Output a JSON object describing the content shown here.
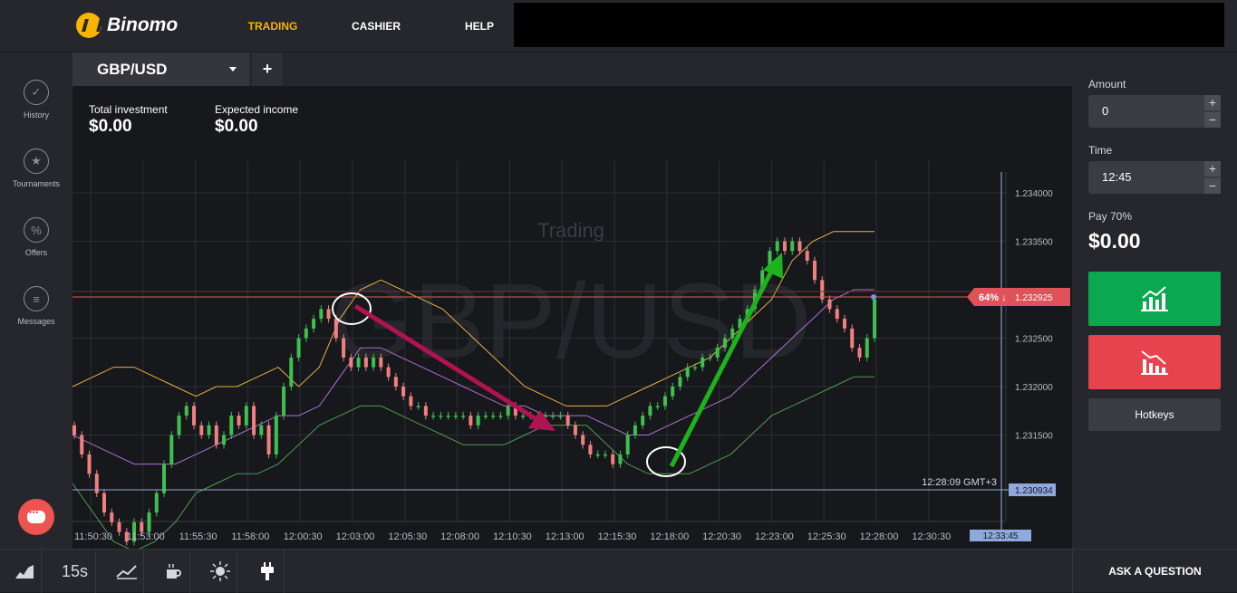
{
  "brand": {
    "name": "Binomo"
  },
  "nav": [
    {
      "label": "TRADING",
      "active": true
    },
    {
      "label": "CASHIER",
      "active": false
    },
    {
      "label": "HELP",
      "active": false
    }
  ],
  "sidebar": [
    {
      "label": "History",
      "icon": "check-icon"
    },
    {
      "label": "Tournaments",
      "icon": "trophy-icon"
    },
    {
      "label": "Offers",
      "icon": "percent-icon"
    },
    {
      "label": "Messages",
      "icon": "messages-icon"
    }
  ],
  "tabs": {
    "pair": "GBP/USD",
    "add": "+"
  },
  "stats": {
    "total_label": "Total investment",
    "total_value": "$0.00",
    "income_label": "Expected income",
    "income_value": "$0.00"
  },
  "chart": {
    "watermark_top": "Trading",
    "watermark_pair": "GBP/USD",
    "current_marker": "64% ↓",
    "current_price": "1.232925",
    "strike_price": "1.230934",
    "time_readout": "12:28:09 GMT+3",
    "end_time": "12:33:45",
    "colors": {
      "up": "#3fbf4f",
      "down": "#f08080",
      "upper_band": "#e7b045",
      "middle_band": "#b06fd0",
      "lower_band": "#4e9a4e",
      "price_line": "#ef5350",
      "strike_line": "#8fa9dd"
    }
  },
  "chart_data": {
    "type": "candlestick",
    "x_ticks": [
      "11:50:30",
      "11:53:00",
      "11:55:30",
      "11:58:00",
      "12:00:30",
      "12:03:00",
      "12:05:30",
      "12:08:00",
      "12:10:30",
      "12:13:00",
      "12:15:30",
      "12:18:00",
      "12:20:30",
      "12:23:00",
      "12:25:30",
      "12:28:00",
      "12:30:30"
    ],
    "y_ticks": [
      "1.234000",
      "1.233500",
      "1.232500",
      "1.232000",
      "1.231500"
    ],
    "ylim": [
      1.2303,
      1.2342
    ],
    "close": [
      1.2315,
      1.2313,
      1.2311,
      1.2309,
      1.2307,
      1.2306,
      1.2305,
      1.2304,
      1.2306,
      1.2305,
      1.2307,
      1.2309,
      1.2312,
      1.2315,
      1.2317,
      1.2318,
      1.2316,
      1.2315,
      1.2316,
      1.2314,
      1.2315,
      1.2317,
      1.2316,
      1.2318,
      1.2315,
      1.2316,
      1.2313,
      1.2317,
      1.232,
      1.2323,
      1.2325,
      1.2326,
      1.2327,
      1.2328,
      1.2327,
      1.2325,
      1.2323,
      1.2322,
      1.2323,
      1.2322,
      1.2323,
      1.2322,
      1.2321,
      1.232,
      1.2319,
      1.2318,
      1.2318,
      1.2317,
      1.2317,
      1.2317,
      1.2317,
      1.2317,
      1.2317,
      1.2316,
      1.2317,
      1.2317,
      1.2317,
      1.2317,
      1.2318,
      1.2317,
      1.2317,
      1.2317,
      1.2317,
      1.2317,
      1.2317,
      1.2317,
      1.2316,
      1.2315,
      1.2314,
      1.2313,
      1.2313,
      1.2313,
      1.2312,
      1.2313,
      1.2315,
      1.2316,
      1.2317,
      1.2318,
      1.2318,
      1.2319,
      1.232,
      1.2321,
      1.2322,
      1.2322,
      1.2323,
      1.2323,
      1.2324,
      1.2325,
      1.2326,
      1.2327,
      1.2328,
      1.233,
      1.2332,
      1.2334,
      1.2335,
      1.2334,
      1.2335,
      1.2334,
      1.2333,
      1.2331,
      1.2329,
      1.2328,
      1.2327,
      1.2326,
      1.2324,
      1.2323,
      1.2325,
      1.2329
    ],
    "upper_band": [
      1.232,
      1.2321,
      1.2322,
      1.2322,
      1.2321,
      1.232,
      1.2319,
      1.232,
      1.232,
      1.2321,
      1.2322,
      1.232,
      1.2322,
      1.2327,
      1.233,
      1.2331,
      1.233,
      1.2329,
      1.2328,
      1.2326,
      1.2324,
      1.2322,
      1.232,
      1.2319,
      1.2318,
      1.2318,
      1.2318,
      1.2319,
      1.232,
      1.2321,
      1.2322,
      1.2323,
      1.2325,
      1.2327,
      1.2329,
      1.2333,
      1.2335,
      1.2336,
      1.2336,
      1.2336
    ],
    "middle_band": [
      1.2315,
      1.2314,
      1.2313,
      1.2312,
      1.2312,
      1.2312,
      1.2313,
      1.2314,
      1.2315,
      1.2316,
      1.2317,
      1.2317,
      1.2318,
      1.2321,
      1.2324,
      1.2324,
      1.2323,
      1.2322,
      1.2321,
      1.232,
      1.2319,
      1.2318,
      1.2318,
      1.2317,
      1.2317,
      1.2317,
      1.2316,
      1.2315,
      1.2315,
      1.2316,
      1.2317,
      1.2318,
      1.2319,
      1.2321,
      1.2323,
      1.2325,
      1.2327,
      1.2329,
      1.233,
      1.233
    ],
    "lower_band": [
      1.231,
      1.2307,
      1.2304,
      1.2303,
      1.2304,
      1.2306,
      1.2309,
      1.231,
      1.2311,
      1.2311,
      1.2312,
      1.2314,
      1.2316,
      1.2317,
      1.2318,
      1.2318,
      1.2317,
      1.2316,
      1.2315,
      1.2314,
      1.2314,
      1.2314,
      1.2315,
      1.2316,
      1.2316,
      1.2316,
      1.2314,
      1.2312,
      1.2311,
      1.2311,
      1.2311,
      1.2312,
      1.2313,
      1.2315,
      1.2317,
      1.2318,
      1.2319,
      1.232,
      1.2321,
      1.2321
    ]
  },
  "right_panel": {
    "amount_label": "Amount",
    "amount_value": "0",
    "time_label": "Time",
    "time_value": "12:45",
    "pay_label": "Pay 70%",
    "pay_value": "$0.00",
    "hotkeys": "Hotkeys"
  },
  "bottom": {
    "interval": "15s",
    "ask": "ASK A QUESTION"
  }
}
